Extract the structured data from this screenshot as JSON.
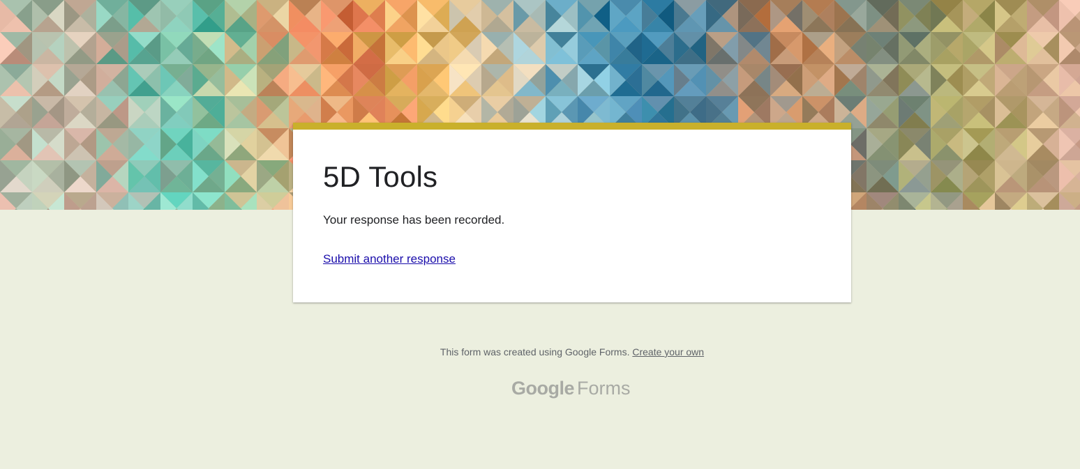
{
  "form": {
    "title": "5D Tools",
    "confirmation_message": "Your response has been recorded.",
    "submit_another_label": "Submit another response",
    "accent_color": "#c9b02b",
    "background_color": "#ecefdf"
  },
  "footer": {
    "created_with_text": "This form was created using Google Forms.",
    "create_your_own_label": "Create your own"
  },
  "brand": {
    "google_word": "Google",
    "forms_word": "Forms"
  },
  "banner": {
    "pattern": "colorful-triangle-mosaic"
  }
}
